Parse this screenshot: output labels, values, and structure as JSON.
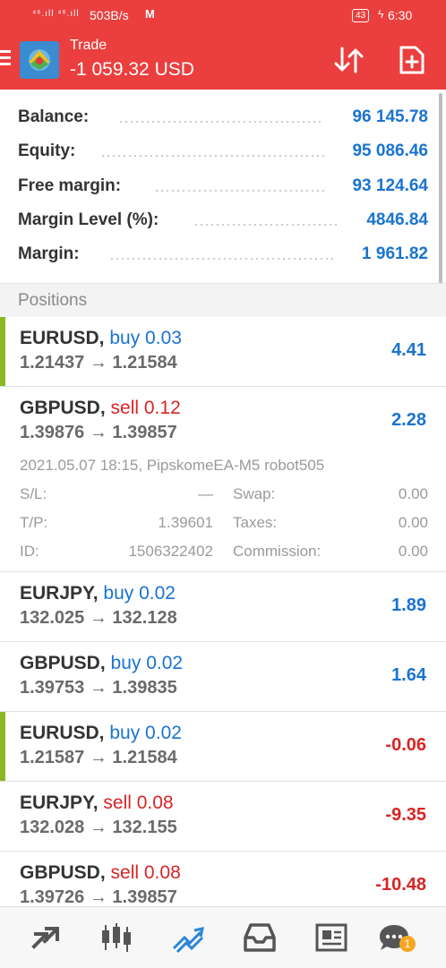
{
  "status_bar": {
    "signal": "⁴⁶.ıll ⁴⁶.ıll",
    "speed": "503B/s",
    "app_badge": "M",
    "battery": "43",
    "time": "6:30"
  },
  "header": {
    "title": "Trade",
    "balance_change": "-1 059.32 USD"
  },
  "account": {
    "rows": [
      {
        "label": "Balance:",
        "value": "96 145.78"
      },
      {
        "label": "Equity:",
        "value": "95 086.46"
      },
      {
        "label": "Free margin:",
        "value": "93 124.64"
      },
      {
        "label": "Margin Level (%):",
        "value": "4846.84"
      },
      {
        "label": "Margin:",
        "value": "1 961.82"
      }
    ]
  },
  "positions_header": "Positions",
  "positions": [
    {
      "symbol": "EURUSD,",
      "side": "buy 0.03",
      "prices": "1.21437 → 1.21584",
      "profit": "4.41"
    },
    {
      "symbol": "GBPUSD,",
      "side": "sell 0.12",
      "prices": "1.39876 → 1.39857",
      "profit": "2.28",
      "details": {
        "opened": "2021.05.07 18:15, PipskomeEA-M5 robot505",
        "sl_label": "S/L:",
        "sl_value": "—",
        "swap_label": "Swap:",
        "swap_value": "0.00",
        "tp_label": "T/P:",
        "tp_value": "1.39601",
        "taxes_label": "Taxes:",
        "taxes_value": "0.00",
        "id_label": "ID:",
        "id_value": "1506322402",
        "commission_label": "Commission:",
        "commission_value": "0.00"
      }
    },
    {
      "symbol": "EURJPY,",
      "side": "buy 0.02",
      "prices": "132.025 → 132.128",
      "profit": "1.89"
    },
    {
      "symbol": "GBPUSD,",
      "side": "buy 0.02",
      "prices": "1.39753 → 1.39835",
      "profit": "1.64"
    },
    {
      "symbol": "EURUSD,",
      "side": "buy 0.02",
      "prices": "1.21587 → 1.21584",
      "profit": "-0.06"
    },
    {
      "symbol": "EURJPY,",
      "side": "sell 0.08",
      "prices": "132.028 → 132.155",
      "profit": "-9.35"
    },
    {
      "symbol": "GBPUSD,",
      "side": "sell 0.08",
      "prices": "1.39726 → 1.39857",
      "profit": "-10.48"
    }
  ],
  "nav": {
    "items": [
      "quotes-icon",
      "chart-icon",
      "trade-icon",
      "history-icon",
      "news-icon",
      "messages-icon"
    ],
    "active": "trade-icon",
    "messages_badge": "1"
  },
  "colors": {
    "header": "#ea3f3e",
    "positive": "#1a73d0",
    "negative": "#d82424",
    "buy_marker": "#8ab820"
  }
}
